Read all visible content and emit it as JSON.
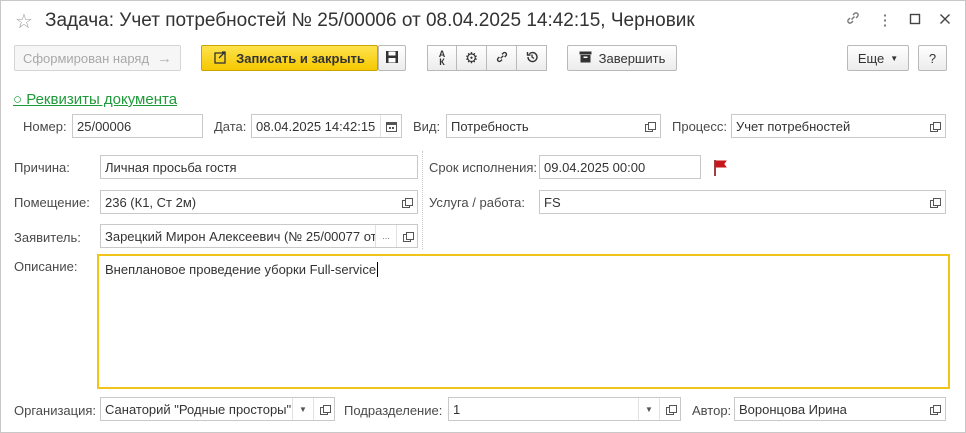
{
  "window": {
    "title": "Задача: Учет потребностей № 25/00006 от 08.04.2025 14:42:15, Черновик"
  },
  "toolbar": {
    "formed_order_label": "Сформирован наряд",
    "save_close_label": "Записать и закрыть",
    "finish_label": "Завершить",
    "more_label": "Еще",
    "help_label": "?"
  },
  "section": {
    "requisites_label": "○ Реквизиты документа"
  },
  "form": {
    "number": {
      "label": "Номер:",
      "value": "25/00006"
    },
    "date": {
      "label": "Дата:",
      "value": "08.04.2025 14:42:15"
    },
    "kind": {
      "label": "Вид:",
      "value": "Потребность"
    },
    "process": {
      "label": "Процесс:",
      "value": "Учет потребностей"
    },
    "reason": {
      "label": "Причина:",
      "value": "Личная просьба гостя"
    },
    "deadline": {
      "label": "Срок исполнения:",
      "value": "09.04.2025 00:00"
    },
    "room": {
      "label": "Помещение:",
      "value": "236 (К1, Ст 2м)"
    },
    "service": {
      "label": "Услуга / работа:",
      "value": "FS"
    },
    "applicant": {
      "label": "Заявитель:",
      "value": "Зарецкий Мирон Алексеевич (№ 25/00077 от"
    },
    "description": {
      "label": "Описание:",
      "value": "Внеплановое проведение уборки Full-service"
    },
    "organization": {
      "label": "Организация:",
      "value": "Санаторий \"Родные просторы\""
    },
    "department": {
      "label": "Подразделение:",
      "value": "1"
    },
    "author": {
      "label": "Автор:",
      "value": "Воронцова Ирина"
    }
  },
  "colors": {
    "accent_yellow": "#f5c800",
    "section_green": "#1f9a3a",
    "flag_red": "#c8161d"
  }
}
